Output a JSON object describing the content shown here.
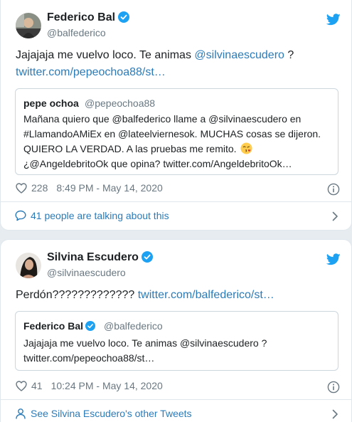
{
  "colors": {
    "link": "#2b7bb9",
    "verified": "#1da1f2",
    "bird": "#1da1f2",
    "muted": "#697882"
  },
  "tweet1": {
    "author": {
      "name": "Federico Bal",
      "handle": "@balfederico",
      "verified": true,
      "avatar_icon": "avatar-photo"
    },
    "text_plain": "Jajajaja me vuelvo loco. Te animas ",
    "text_mention": "@silvinaescudero",
    "text_end": " ?",
    "text_link": "twitter.com/pepeochoa88/st…",
    "quoted": {
      "name": "pepe ochoa",
      "handle": "@pepeochoa88",
      "lines": [
        "Mañana quiero que @balfederico llame a @silvinaescudero en",
        "#LlamandoAMiEx en @lateelviernesok. MUCHAS cosas se dijeron.",
        "QUIERO LA VERDAD. A las pruebas me remito.",
        "¿@AngeldebritoOk que opina? twitter.com/AngeldebritoOk…"
      ],
      "emoji_icon": "kiss-emoji-icon"
    },
    "likes": "228",
    "timestamp": "8:49 PM - May 14, 2020",
    "footer": "41 people are talking about this",
    "footer_icon": "speech-bubble-icon"
  },
  "tweet2": {
    "author": {
      "name": "Silvina Escudero",
      "handle": "@silvinaescudero",
      "verified": true,
      "avatar_icon": "avatar-photo"
    },
    "text_plain": "Perdón????????????? ",
    "text_link": "twitter.com/balfederico/st…",
    "quoted": {
      "name": "Federico Bal",
      "handle": "@balfederico",
      "verified": true,
      "lines": [
        "Jajajaja me vuelvo loco. Te animas @silvinaescudero ?",
        "twitter.com/pepeochoa88/st…"
      ]
    },
    "likes": "41",
    "timestamp": "10:24 PM - May 14, 2020",
    "footer": "See Silvina Escudero's other Tweets",
    "footer_icon": "person-icon"
  }
}
